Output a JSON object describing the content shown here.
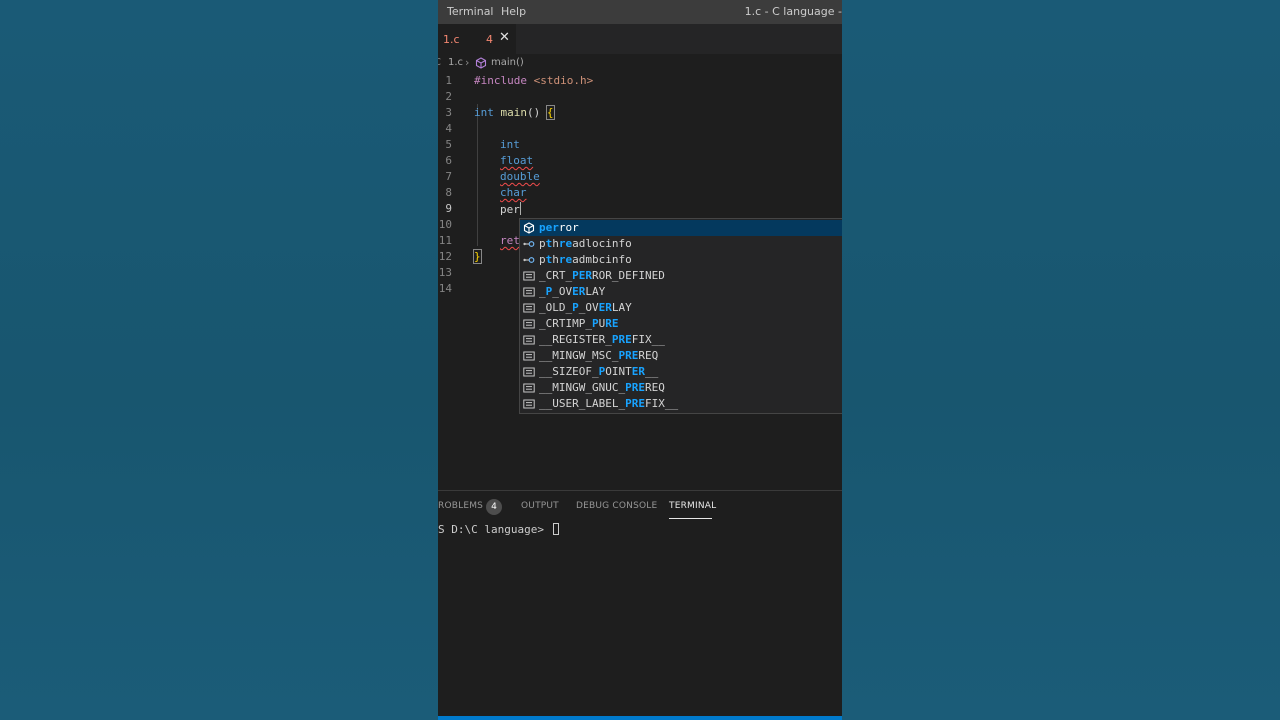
{
  "menu": {
    "terminal": "Terminal",
    "help": "Help"
  },
  "window_title": "1.c - C language -",
  "tab": {
    "filename": "1.c",
    "problem_count": "4",
    "close_glyph": "✕"
  },
  "breadcrumb": {
    "file": "1.c",
    "separator": "›",
    "symbol": "main()"
  },
  "editor": {
    "line_numbers": [
      "1",
      "2",
      "3",
      "4",
      "5",
      "6",
      "7",
      "8",
      "9",
      "10",
      "11",
      "12",
      "13",
      "14"
    ],
    "active_line": "9",
    "lines": {
      "l1_pp": "#include",
      "l1_header": " <stdio.h>",
      "l3_type": "int",
      "l3_fn": "main",
      "l3_parens": "() ",
      "l3_brace": "{",
      "l5": "int",
      "l6": "float",
      "l7": "double",
      "l8": "char",
      "l9": "per",
      "l11": "ret",
      "l12": "}"
    }
  },
  "suggestions": [
    {
      "icon": "cube-icon",
      "match": "per",
      "rest": "ror",
      "selected": true
    },
    {
      "icon": "field-icon",
      "prefix": "p",
      "m1": "t",
      "mid": "h",
      "m2": "re",
      "rest": "adlocinfo"
    },
    {
      "icon": "field-icon",
      "prefix": "p",
      "m1": "t",
      "mid": "h",
      "m2": "re",
      "rest": "admbcinfo"
    },
    {
      "icon": "text-icon",
      "pre": "_CRT_",
      "match": "PER",
      "rest": "ROR_DEFINED"
    },
    {
      "icon": "text-icon",
      "pre": "_",
      "m1": "P",
      "mid": "_OV",
      "m2": "ER",
      "rest": "LAY"
    },
    {
      "icon": "text-icon",
      "pre": "_OLD_",
      "m1": "P",
      "mid": "_OV",
      "m2": "ER",
      "rest": "LAY"
    },
    {
      "icon": "text-icon",
      "pre": "_CRTIMP_",
      "m1": "P",
      "mid": "U",
      "m2": "RE",
      "rest": ""
    },
    {
      "icon": "text-icon",
      "pre": "__REGISTER_",
      "match": "PRE",
      "rest": "FIX__"
    },
    {
      "icon": "text-icon",
      "pre": "__MINGW_MSC_",
      "match": "PRE",
      "rest": "REQ"
    },
    {
      "icon": "text-icon",
      "pre": "__SIZEOF_",
      "m1": "P",
      "mid": "OINT",
      "m2": "ER",
      "rest": "__"
    },
    {
      "icon": "text-icon",
      "pre": "__MINGW_GNUC_",
      "match": "PRE",
      "rest": "REQ"
    },
    {
      "icon": "text-icon",
      "pre": "__USER_LABEL_",
      "match": "PRE",
      "rest": "FIX__"
    }
  ],
  "panel": {
    "tabs": {
      "problems": "ROBLEMS",
      "output": "OUTPUT",
      "debug_console": "DEBUG CONSOLE",
      "terminal": "TERMINAL"
    },
    "problems_badge": "4",
    "active_tab": "TERMINAL"
  },
  "terminal": {
    "prompt": "S D:\\C language> "
  },
  "colors": {
    "background": "#1b5a76",
    "editor_bg": "#1e1e1e",
    "accent_blue": "#007acc",
    "match_highlight": "#18a3ff",
    "error_tab": "#f48771"
  }
}
